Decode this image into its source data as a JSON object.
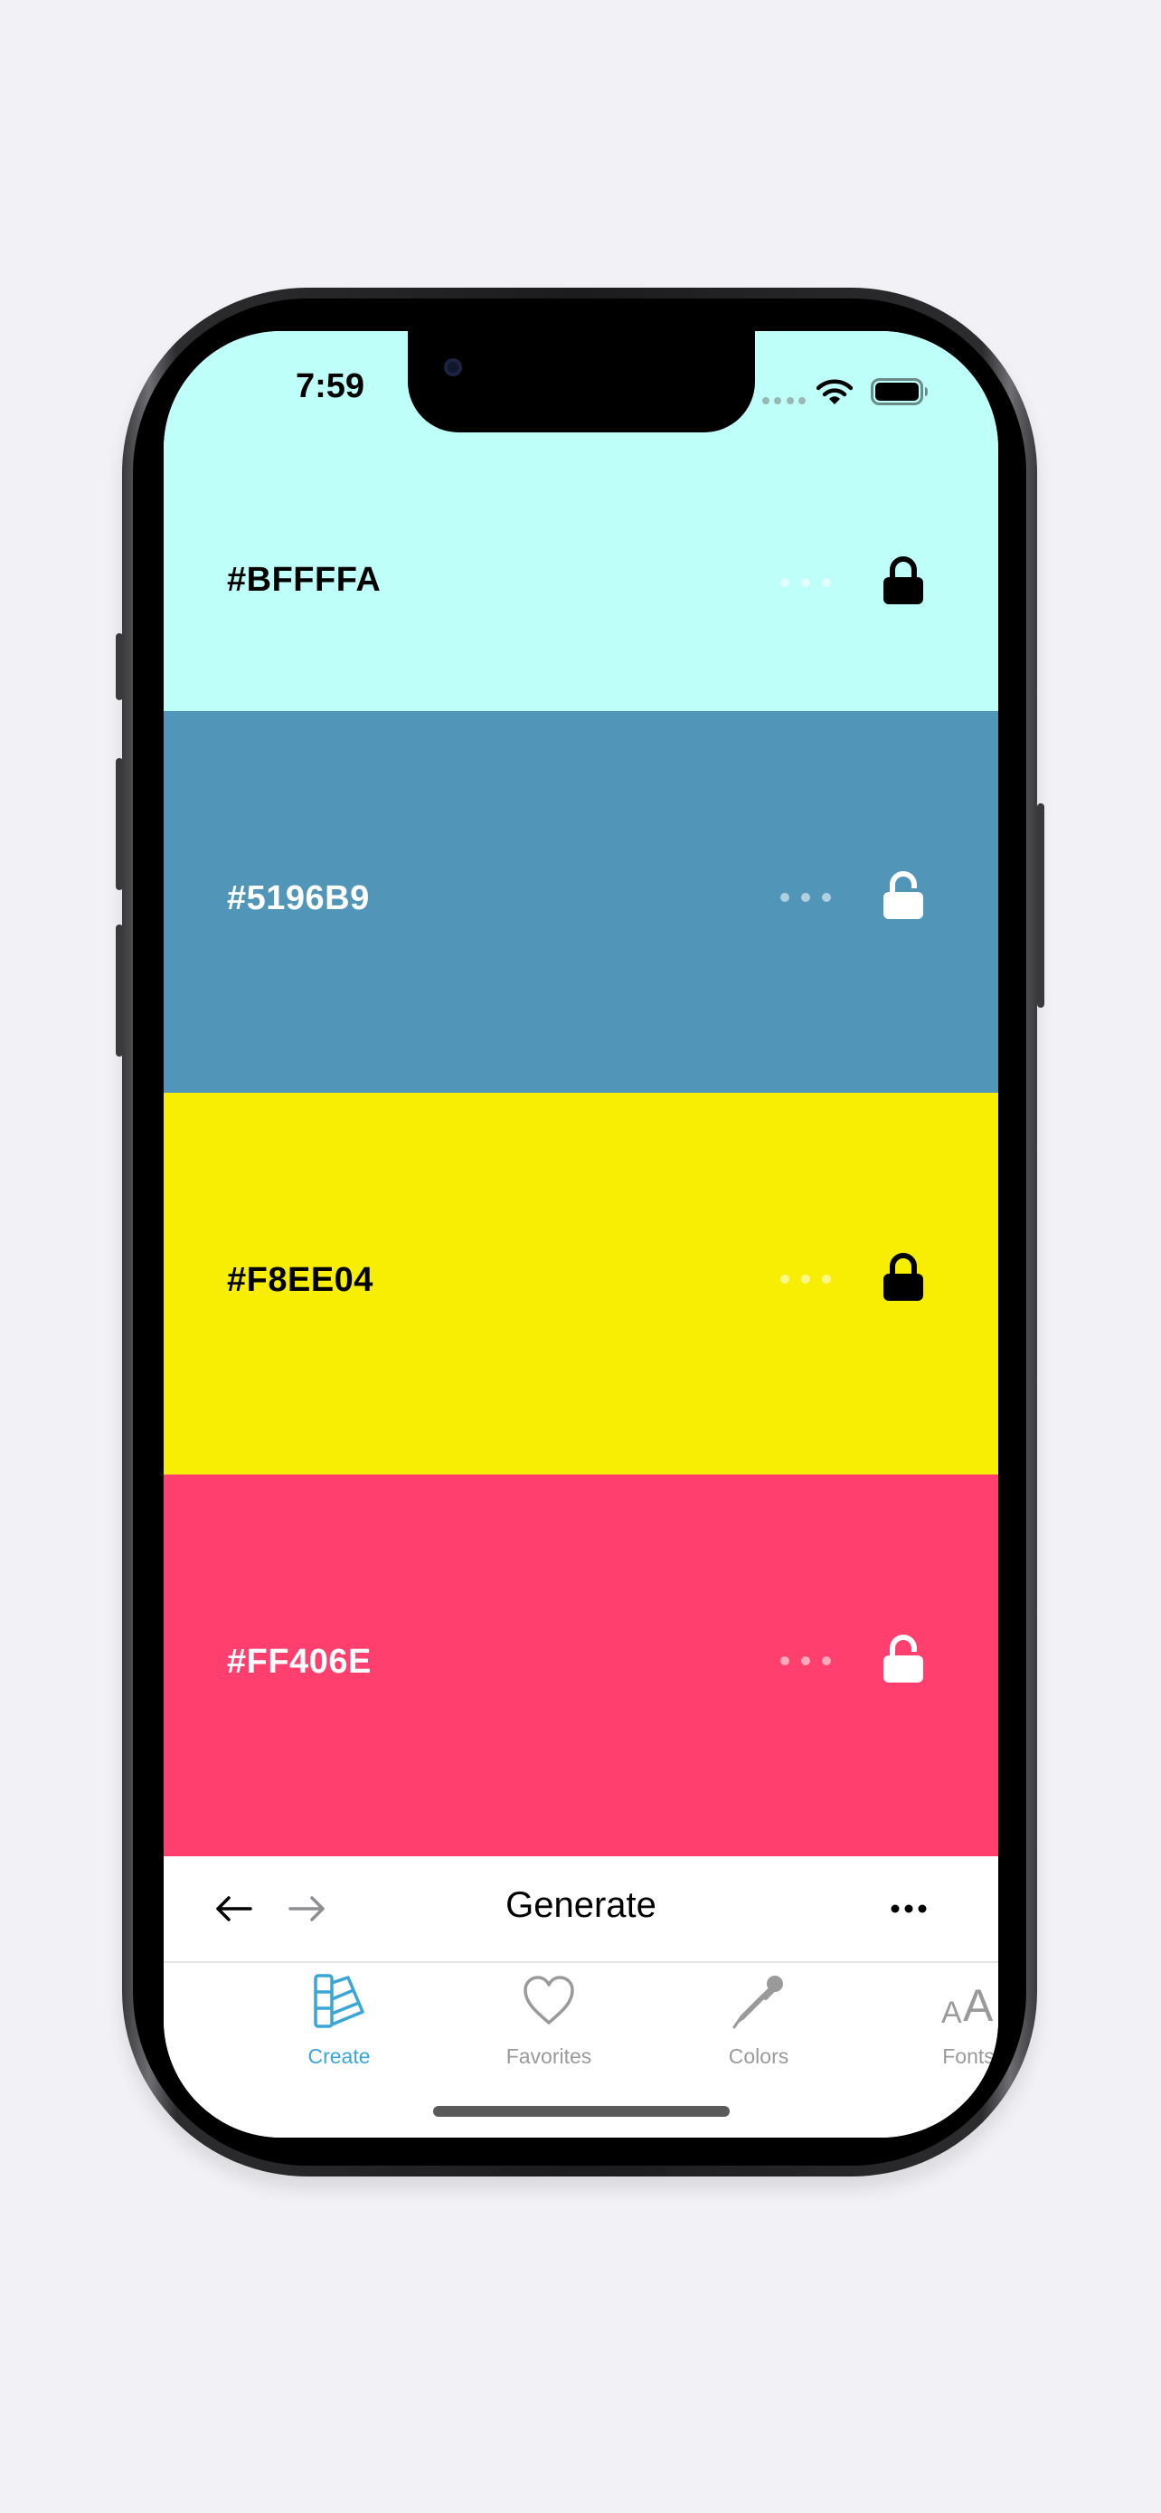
{
  "status_bar": {
    "time": "7:59"
  },
  "colors": {
    "accent": "#3aa6d6",
    "inactive_tab": "#9a9a9a"
  },
  "swatches": [
    {
      "hex_label": "#BFFFFA",
      "background": "#BFFFFA",
      "text_color": "#000000",
      "locked": true
    },
    {
      "hex_label": "#5196B9",
      "background": "#5196B9",
      "text_color": "#FFFFFF",
      "locked": false
    },
    {
      "hex_label": "#F8EE04",
      "background": "#F8EE04",
      "text_color": "#000000",
      "locked": true
    },
    {
      "hex_label": "#FF406E",
      "background": "#FF406E",
      "text_color": "#FFFFFF",
      "locked": false
    }
  ],
  "toolbar": {
    "back_icon": "arrow-left-icon",
    "forward_icon": "arrow-right-icon",
    "generate_label": "Generate",
    "more_icon": "ellipsis-icon"
  },
  "tabbar": {
    "tabs": [
      {
        "label": "Create",
        "icon": "color-fan-icon",
        "active": true
      },
      {
        "label": "Favorites",
        "icon": "heart-icon",
        "active": false
      },
      {
        "label": "Colors",
        "icon": "eyedropper-icon",
        "active": false
      },
      {
        "label": "Fonts",
        "icon": "font-size-icon",
        "active": false
      }
    ]
  }
}
